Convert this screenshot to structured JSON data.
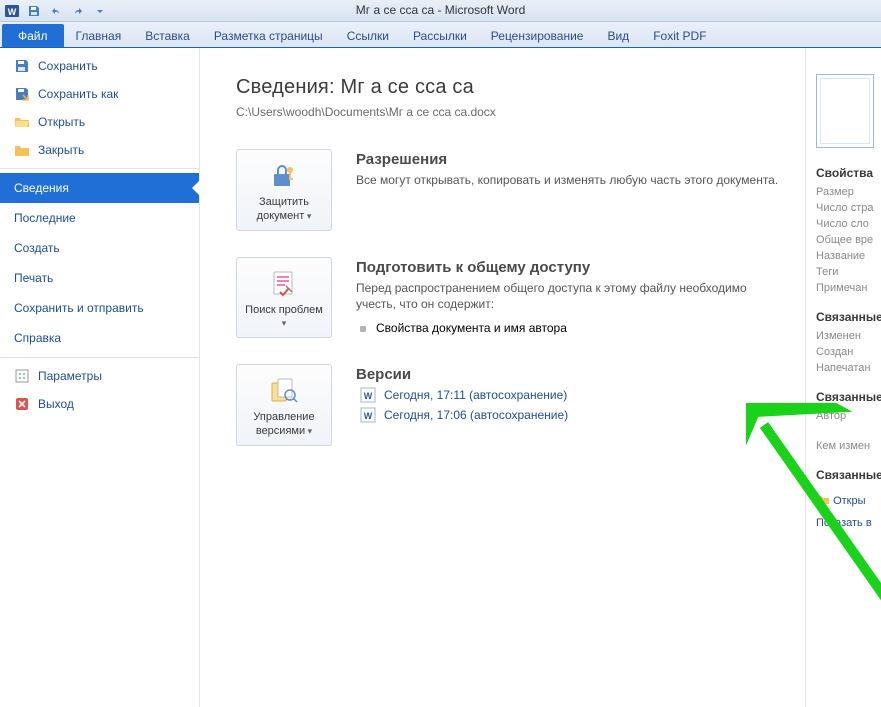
{
  "title": "Mг а се  сса са  -  Microsoft Word",
  "ribbon": {
    "file": "Файл",
    "home": "Главная",
    "insert": "Вставка",
    "layout": "Разметка страницы",
    "refs": "Ссылки",
    "mail": "Рассылки",
    "review": "Рецензирование",
    "view": "Вид",
    "foxit": "Foxit PDF"
  },
  "nav": {
    "save": "Сохранить",
    "save_as": "Сохранить как",
    "open": "Открыть",
    "close": "Закрыть",
    "info": "Сведения",
    "recent": "Последние",
    "new": "Создать",
    "print": "Печать",
    "sendsave": "Сохранить и отправить",
    "help": "Справка",
    "options": "Параметры",
    "exit": "Выход"
  },
  "main": {
    "heading": "Сведения: Mг а се  сса са",
    "path": "C:\\Users\\woodh\\Documents\\Mг а се  сса са.docx",
    "permissions": {
      "btn": "Защитить документ",
      "title": "Разрешения",
      "text": "Все могут открывать, копировать и изменять любую часть этого документа."
    },
    "prepare": {
      "btn": "Поиск проблем",
      "title": "Подготовить к общему доступу",
      "text": "Перед распространением общего доступа к этому файлу необходимо учесть, что он содержит:",
      "bullet1": "Свойства документа и имя автора"
    },
    "versions": {
      "btn": "Управление версиями",
      "title": "Версии",
      "v1": "Сегодня, 17:11 (автосохранение)",
      "v2": "Сегодня, 17:06 (автосохранение)"
    }
  },
  "right": {
    "props": "Свойства",
    "size": "Размер",
    "pages": "Число стра",
    "words": "Число сло",
    "edit_time": "Общее вре",
    "name": "Название",
    "tags": "Теги",
    "comments": "Примечан",
    "related": "Связанные",
    "modified": "Изменен",
    "created": "Создан",
    "printed": "Напечатан",
    "related2": "Связанные",
    "author": "Автор",
    "whochanged": "Кем измен",
    "related3": "Связанные",
    "openloc": "Откры",
    "showall": "Показать в"
  }
}
